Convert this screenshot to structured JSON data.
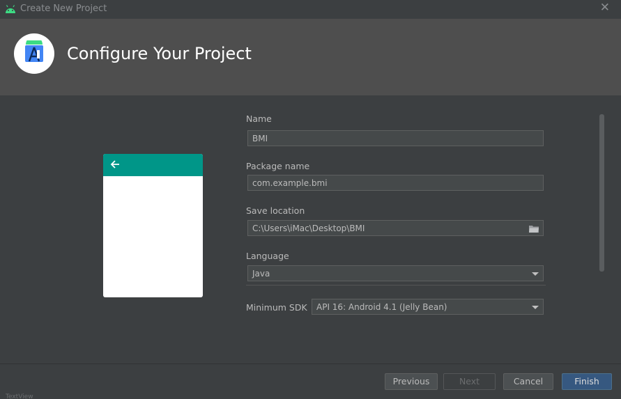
{
  "window": {
    "title": "Create New Project",
    "close_glyph": "✕"
  },
  "header": {
    "heading": "Configure Your Project"
  },
  "form": {
    "name_label": "Name",
    "name_value": "BMI",
    "package_label": "Package name",
    "package_value": "com.example.bmi",
    "location_label": "Save location",
    "location_value": "C:\\Users\\iMac\\Desktop\\BMI",
    "language_label": "Language",
    "language_value": "Java",
    "min_sdk_label": "Minimum SDK",
    "min_sdk_value": "API 16: Android 4.1 (Jelly Bean)"
  },
  "footer": {
    "previous_label": "Previous",
    "next_label": "Next",
    "cancel_label": "Cancel",
    "finish_label": "Finish",
    "partial_text": "TextView"
  },
  "colors": {
    "header_bg": "#4e4e4e",
    "app_bar": "#009688",
    "primary_button": "#365880",
    "android_green": "#3ddc84"
  },
  "icons": [
    "android-icon",
    "close-icon",
    "android-studio-logo-icon",
    "back-arrow-icon",
    "folder-icon",
    "chevron-down-icon"
  ]
}
